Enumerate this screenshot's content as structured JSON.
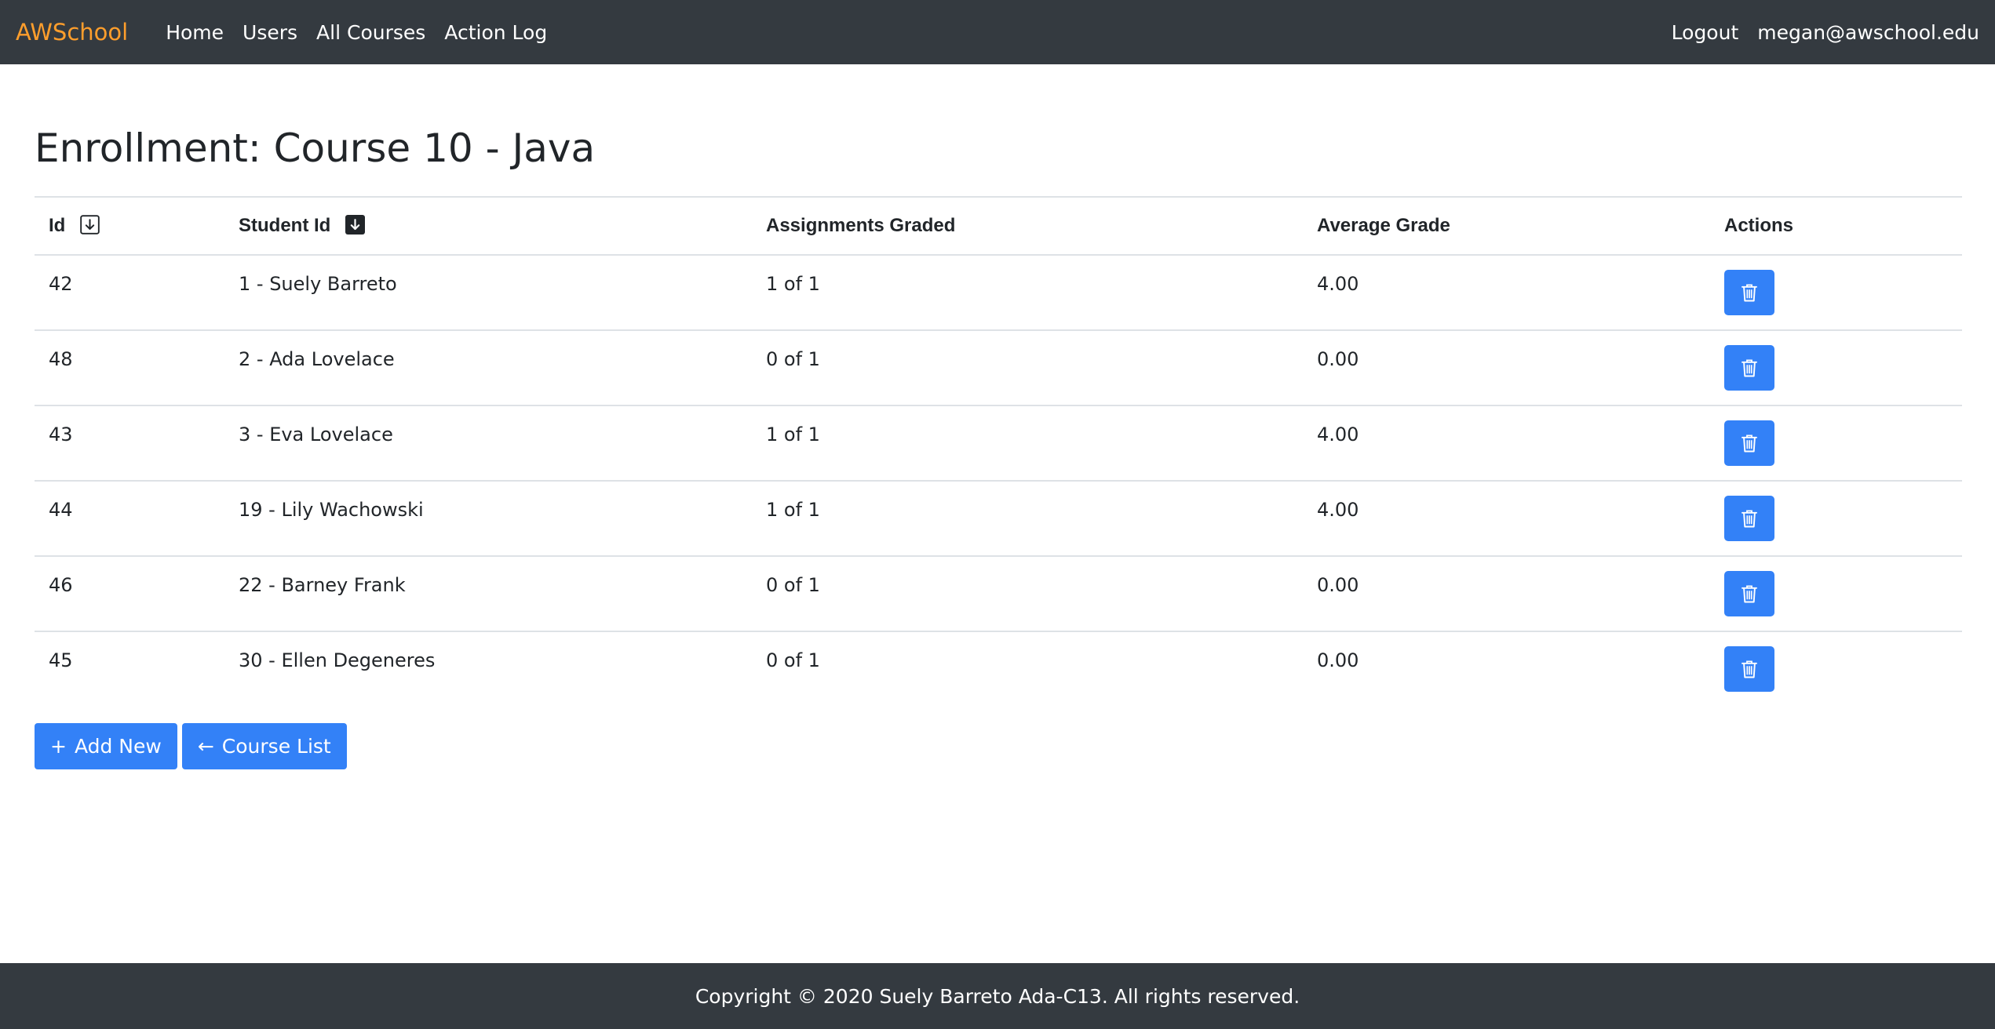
{
  "nav": {
    "brand": "AWSchool",
    "links": [
      "Home",
      "Users",
      "All Courses",
      "Action Log"
    ],
    "logout": "Logout",
    "user_email": "megan@awschool.edu"
  },
  "page": {
    "title": "Enrollment: Course 10 - Java"
  },
  "table": {
    "headers": {
      "id": "Id",
      "student_id": "Student Id",
      "assignments_graded": "Assignments Graded",
      "average_grade": "Average Grade",
      "actions": "Actions"
    },
    "rows": [
      {
        "id": "42",
        "student": "1 - Suely Barreto",
        "graded": "1 of 1",
        "avg": "4.00"
      },
      {
        "id": "48",
        "student": "2 - Ada Lovelace",
        "graded": "0 of 1",
        "avg": "0.00"
      },
      {
        "id": "43",
        "student": "3 - Eva Lovelace",
        "graded": "1 of 1",
        "avg": "4.00"
      },
      {
        "id": "44",
        "student": "19 - Lily Wachowski",
        "graded": "1 of 1",
        "avg": "4.00"
      },
      {
        "id": "46",
        "student": "22 - Barney Frank",
        "graded": "0 of 1",
        "avg": "0.00"
      },
      {
        "id": "45",
        "student": "30 - Ellen Degeneres",
        "graded": "0 of 1",
        "avg": "0.00"
      }
    ],
    "delete_icon": "trash-icon"
  },
  "buttons": {
    "add_new_glyph": "+",
    "add_new": "Add New",
    "course_list_glyph": "←",
    "course_list": "Course List"
  },
  "icons": {
    "sort_id": "sort-arrow-down-outline-icon",
    "sort_student": "sort-arrow-down-filled-icon"
  },
  "colors": {
    "navbar_bg": "#343a40",
    "brand": "#ff9e2c",
    "primary": "#3381f7"
  },
  "footer": {
    "text": "Copyright © 2020 Suely Barreto Ada-C13. All rights reserved."
  }
}
